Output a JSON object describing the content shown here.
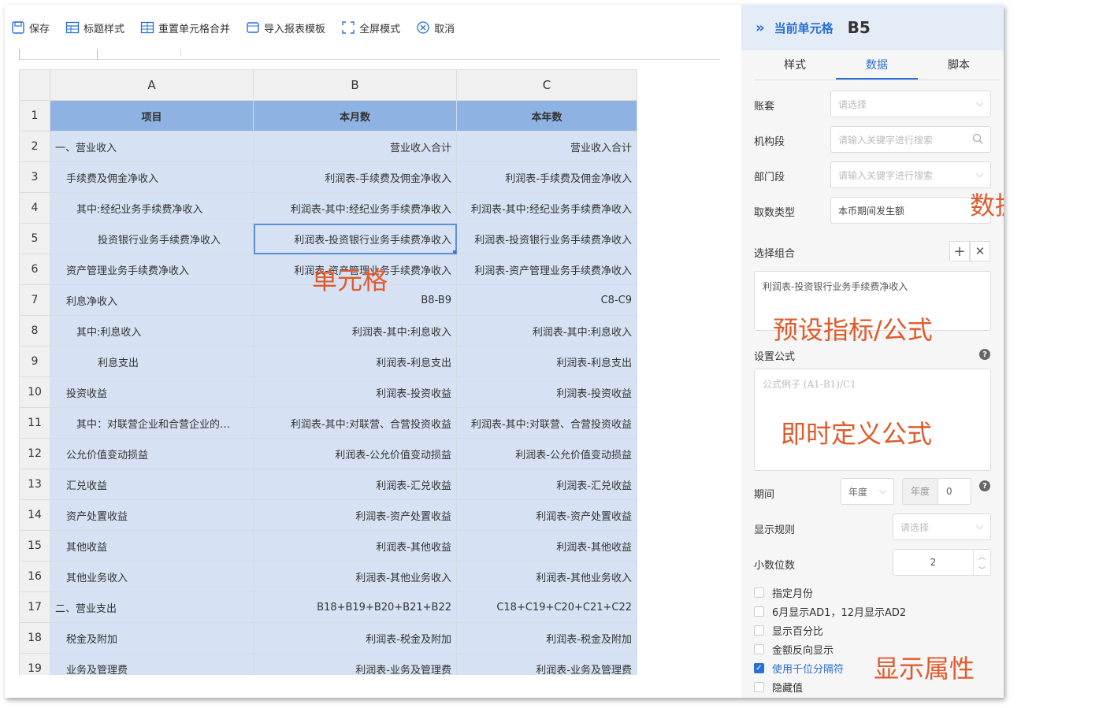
{
  "toolbar": {
    "buttons": [
      {
        "label": "保存",
        "icon": "save-icon"
      },
      {
        "label": "标题样式",
        "icon": "table-header-icon"
      },
      {
        "label": "重置单元格合并",
        "icon": "table-merge-icon"
      },
      {
        "label": "导入报表模板",
        "icon": "import-template-icon"
      },
      {
        "label": "全屏模式",
        "icon": "fullscreen-icon"
      },
      {
        "label": "取消",
        "icon": "cancel-circle-icon"
      }
    ]
  },
  "grid": {
    "columns": [
      "A",
      "B",
      "C"
    ],
    "header_row": {
      "num": "1",
      "a": "项目",
      "b": "本月数",
      "c": "本年数"
    },
    "rows": [
      {
        "num": "2",
        "a": "一、营业收入",
        "b": "营业收入合计",
        "c": "营业收入合计",
        "indent": 0
      },
      {
        "num": "3",
        "a": "手续费及佣金净收入",
        "b": "利润表-手续费及佣金净收入",
        "c": "利润表-手续费及佣金净收入",
        "indent": 1
      },
      {
        "num": "4",
        "a": "其中:经纪业务手续费净收入",
        "b": "利润表-其中:经纪业务手续费净收入",
        "c": "利润表-其中:经纪业务手续费净收入",
        "indent": 2
      },
      {
        "num": "5",
        "a": "投资银行业务手续费净收入",
        "b": "利润表-投资银行业务手续费净收入",
        "c": "利润表-投资银行业务手续费净收入",
        "indent": 3
      },
      {
        "num": "6",
        "a": "资产管理业务手续费净收入",
        "b": "利润表-资产管理业务手续费净收入",
        "c": "利润表-资产管理业务手续费净收入",
        "indent": 1
      },
      {
        "num": "7",
        "a": "利息净收入",
        "b": "B8-B9",
        "c": "C8-C9",
        "indent": 1
      },
      {
        "num": "8",
        "a": "其中:利息收入",
        "b": "利润表-其中:利息收入",
        "c": "利润表-其中:利息收入",
        "indent": 2
      },
      {
        "num": "9",
        "a": "利息支出",
        "b": "利润表-利息支出",
        "c": "利润表-利息支出",
        "indent": 3
      },
      {
        "num": "10",
        "a": "投资收益",
        "b": "利润表-投资收益",
        "c": "利润表-投资收益",
        "indent": 1
      },
      {
        "num": "11",
        "a": "其中：对联营企业和合营企业的…",
        "b": "利润表-其中:对联营、合营投资收益",
        "c": "利润表-其中:对联营、合营投资收益",
        "indent": 2
      },
      {
        "num": "12",
        "a": "公允价值变动损益",
        "b": "利润表-公允价值变动损益",
        "c": "利润表-公允价值变动损益",
        "indent": 1
      },
      {
        "num": "13",
        "a": "汇兑收益",
        "b": "利润表-汇兑收益",
        "c": "利润表-汇兑收益",
        "indent": 1
      },
      {
        "num": "14",
        "a": "资产处置收益",
        "b": "利润表-资产处置收益",
        "c": "利润表-资产处置收益",
        "indent": 1
      },
      {
        "num": "15",
        "a": "其他收益",
        "b": "利润表-其他收益",
        "c": "利润表-其他收益",
        "indent": 1
      },
      {
        "num": "16",
        "a": "其他业务收入",
        "b": "利润表-其他业务收入",
        "c": "利润表-其他业务收入",
        "indent": 1
      },
      {
        "num": "17",
        "a": "二、营业支出",
        "b": "B18+B19+B20+B21+B22",
        "c": "C18+C19+C20+C21+C22",
        "indent": 0
      },
      {
        "num": "18",
        "a": "税金及附加",
        "b": "利润表-税金及附加",
        "c": "利润表-税金及附加",
        "indent": 1
      },
      {
        "num": "19",
        "a": "业务及管理费",
        "b": "利润表-业务及管理费",
        "c": "利润表-业务及管理费",
        "indent": 1
      }
    ],
    "selected_cell": "B5"
  },
  "panel": {
    "title": "当前单元格",
    "cell_ref": "B5",
    "tabs": [
      "样式",
      "数据",
      "脚本"
    ],
    "active_tab": "数据",
    "fields": {
      "account_label": "账套",
      "account_placeholder": "请选择",
      "org_label": "机构段",
      "org_placeholder": "请输入关键字进行搜索",
      "dept_label": "部门段",
      "dept_placeholder": "请输入关键字进行搜索",
      "fetch_label": "取数类型",
      "fetch_value": "本币期间发生额",
      "combo_label": "选择组合",
      "combo_value": "利润表-投资银行业务手续费净收入",
      "formula_label": "设置公式",
      "formula_placeholder": "公式例子 (A1-B1)/C1",
      "period_label": "期间",
      "period_select": "年度",
      "period_unit": "年度",
      "period_offset": "0",
      "display_rule_label": "显示规则",
      "display_rule_placeholder": "请选择",
      "decimal_label": "小数位数",
      "decimal_value": "2"
    },
    "checkboxes": [
      {
        "label": "指定月份",
        "checked": false
      },
      {
        "label": "6月显示AD1，12月显示AD2",
        "checked": false
      },
      {
        "label": "显示百分比",
        "checked": false
      },
      {
        "label": "金额反向显示",
        "checked": false
      },
      {
        "label": "使用千位分隔符",
        "checked": true
      },
      {
        "label": "隐藏值",
        "checked": false
      }
    ]
  },
  "annotations": {
    "cell": "单元格",
    "data_filter": "数据过滤",
    "preset": "预设指标/公式",
    "instant_formula": "即时定义公式",
    "display_props": "显示属性"
  },
  "colors": {
    "accent": "#2a6fd3",
    "header_fill": "#8eb3e3",
    "cell_fill": "#d6e2f3",
    "annotation": "#e05a2a"
  }
}
